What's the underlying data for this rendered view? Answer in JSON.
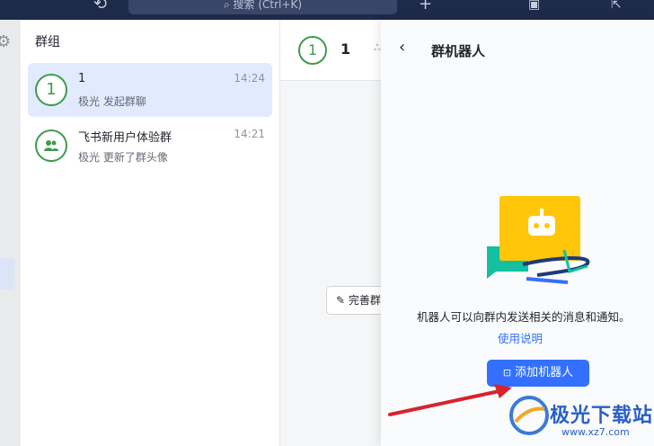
{
  "topbar": {
    "search_placeholder": "搜索 (Ctrl+K)",
    "history_icon": "history-icon",
    "add_icon": "plus-icon",
    "device_icon": "devices-icon"
  },
  "chatlist": {
    "title": "群组",
    "items": [
      {
        "avatar": "1",
        "name": "1",
        "time": "14:24",
        "preview": "极光 发起群聊"
      },
      {
        "avatar": "group-icon",
        "name": "飞书新用户体验群",
        "time": "14:21",
        "preview": "极光 更新了群头像"
      }
    ]
  },
  "main": {
    "avatar": "1",
    "title": "1",
    "complete_button": "完善群"
  },
  "panel": {
    "title": "群机器人",
    "description": "机器人可以向群内发送相关的消息和通知。",
    "usage_link": "使用说明",
    "add_button": "添加机器人"
  },
  "watermark": {
    "text": "极光下载站",
    "url": "www.xz7.com"
  },
  "colors": {
    "accent": "#3370ff",
    "topbar": "#1e2a4a",
    "avatar_green": "#3f9a4b",
    "robot_yellow": "#ffc60a",
    "teal": "#14c0a0",
    "arrow_red": "#d8232a"
  }
}
